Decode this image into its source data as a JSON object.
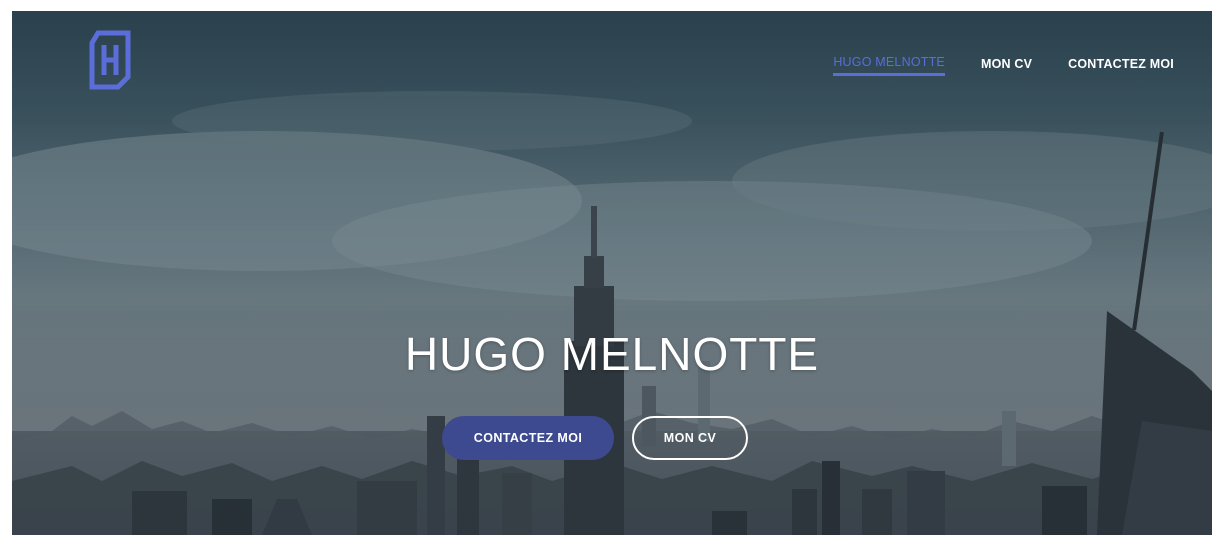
{
  "colors": {
    "accent": "#5b6dd9",
    "primary_button": "#3e4a8f",
    "text": "#ffffff"
  },
  "header": {
    "logo_icon": "letter-h-logo",
    "nav": [
      {
        "label": "HUGO MELNOTTE",
        "active": true
      },
      {
        "label": "MON CV",
        "active": false
      },
      {
        "label": "CONTACTEZ MOI",
        "active": false
      }
    ]
  },
  "hero": {
    "title": "HUGO MELNOTTE",
    "buttons": {
      "primary_label": "CONTACTEZ MOI",
      "secondary_label": "MON CV"
    }
  }
}
